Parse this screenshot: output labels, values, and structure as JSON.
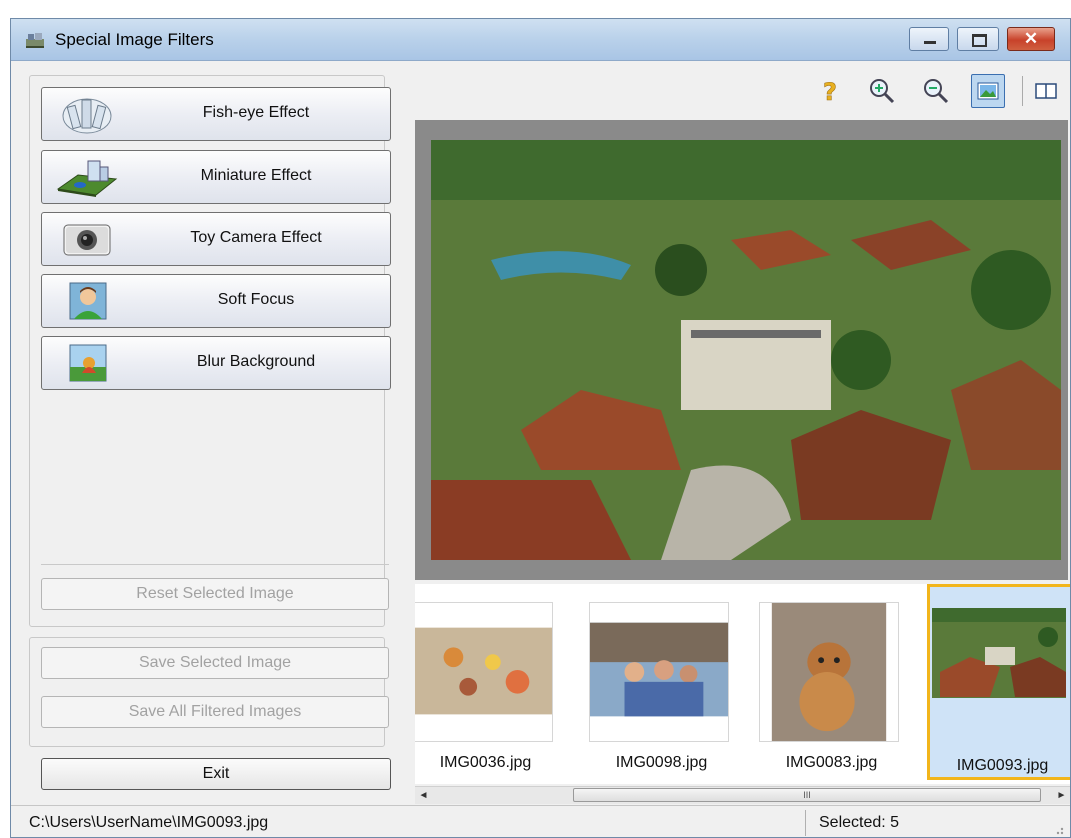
{
  "window": {
    "title": "Special Image Filters",
    "close_glyph": "✕"
  },
  "effects": [
    {
      "label": "Fish-eye Effect",
      "icon": "fisheye-icon"
    },
    {
      "label": "Miniature Effect",
      "icon": "miniature-icon"
    },
    {
      "label": "Toy Camera Effect",
      "icon": "camera-icon"
    },
    {
      "label": "Soft Focus",
      "icon": "portrait-icon"
    },
    {
      "label": "Blur Background",
      "icon": "blur-background-icon"
    }
  ],
  "actions": {
    "reset": "Reset Selected Image",
    "save_selected": "Save Selected Image",
    "save_all": "Save All Filtered Images",
    "exit": "Exit"
  },
  "toolbar": {
    "icons": [
      "help-icon",
      "zoom-in-icon",
      "zoom-out-icon",
      "single-view-icon",
      "compare-view-icon"
    ],
    "active": "single-view-icon"
  },
  "thumbnails": [
    {
      "name": "IMG0036.jpg",
      "selected": false
    },
    {
      "name": "IMG0098.jpg",
      "selected": false
    },
    {
      "name": "IMG0083.jpg",
      "selected": false
    },
    {
      "name": "IMG0093.jpg",
      "selected": true
    }
  ],
  "scrollbar": {
    "left_arrow": "◄",
    "right_arrow": "►",
    "grip": "III"
  },
  "status": {
    "path": "C:\\Users\\UserName\\IMG0093.jpg",
    "selected": "Selected: 5"
  },
  "colors": {
    "selection_border": "#f2b51b",
    "titlebar": "#b9d1ea",
    "preview_bg": "#8a8a8a"
  }
}
